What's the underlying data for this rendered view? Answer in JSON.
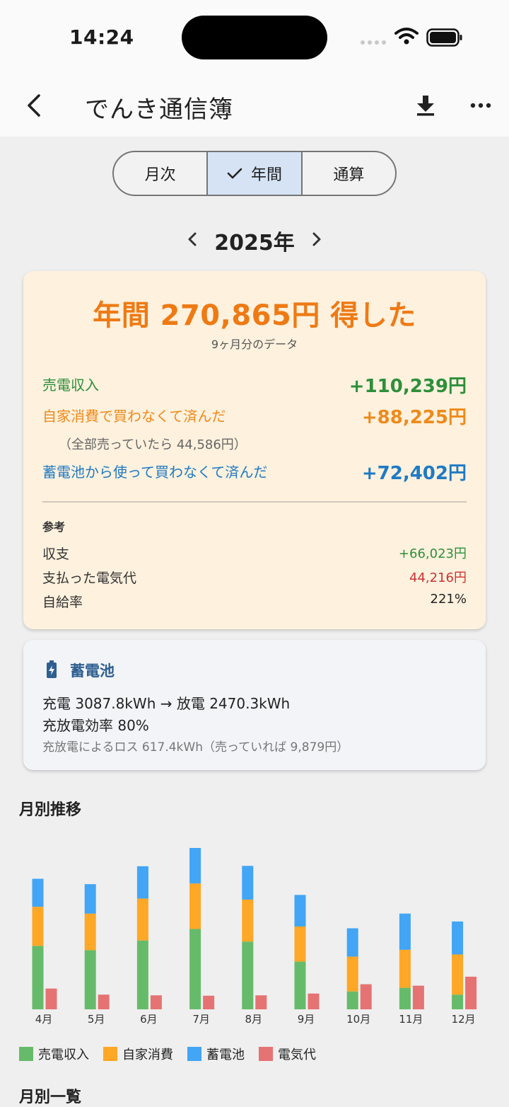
{
  "status": {
    "time": "14:24"
  },
  "app": {
    "title": "でんき通信簿"
  },
  "segment": {
    "items": [
      "月次",
      "年間",
      "通算"
    ],
    "selected": "年間"
  },
  "year": {
    "label": "2025年"
  },
  "summary": {
    "headline": "年間 270,865円 得した",
    "subline": "9ヶ月分のデータ",
    "sale_label": "売電収入",
    "sale_value": "+110,239円",
    "self_label": "自家消費で買わなくて済んだ",
    "self_value": "+88,225円",
    "self_note": "（全部売っていたら 44,586円）",
    "battery_label": "蓄電池から使って買わなくて済んだ",
    "battery_value": "+72,402円",
    "ref_title": "参考",
    "balance_label": "収支",
    "balance_value": "+66,023円",
    "paid_label": "支払った電気代",
    "paid_value": "44,216円",
    "selfsuff_label": "自給率",
    "selfsuff_value": "221%"
  },
  "battery_card": {
    "title": "蓄電池",
    "line1": "充電 3087.8kWh → 放電 2470.3kWh",
    "line2": "充放電効率 80%",
    "line3": "充放電によるロス 617.4kWh（売っていれば 9,879円）"
  },
  "sections": {
    "monthly_trend": "月別推移",
    "monthly_list": "月別一覧"
  },
  "colors": {
    "sale": "#66bb6a",
    "self": "#ffa726",
    "battery": "#42a5f5",
    "cost": "#e57373",
    "accent": "#ee7a14"
  },
  "chart_data": {
    "type": "bar",
    "categories": [
      "4月",
      "5月",
      "6月",
      "7月",
      "8月",
      "9月",
      "10月",
      "11月",
      "12月"
    ],
    "series": [
      {
        "name": "売電収入",
        "values": [
          17700,
          16500,
          19200,
          22400,
          18900,
          13300,
          5000,
          6000,
          4100
        ]
      },
      {
        "name": "自家消費",
        "values": [
          10900,
          10200,
          11700,
          12700,
          11700,
          9800,
          9700,
          10600,
          11200
        ]
      },
      {
        "name": "蓄電池",
        "values": [
          7800,
          8200,
          9000,
          9900,
          9400,
          8800,
          7900,
          10100,
          9200
        ]
      },
      {
        "name": "電気代",
        "values": [
          5800,
          4100,
          3900,
          3800,
          3900,
          4400,
          7000,
          6600,
          9100
        ]
      }
    ],
    "stacked_series": [
      "売電収入",
      "自家消費",
      "蓄電池"
    ],
    "separate_series": [
      "電気代"
    ],
    "ylim": [
      0,
      45000
    ],
    "legend": "bottom-left"
  }
}
